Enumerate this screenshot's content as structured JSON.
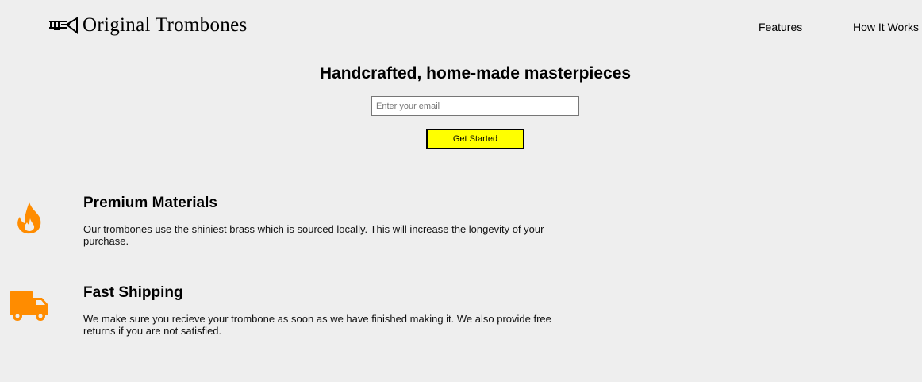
{
  "header": {
    "logo_text": "Original Trombones",
    "logo_icon": "trombone-icon",
    "nav": [
      {
        "label": "Features"
      },
      {
        "label": "How It Works"
      }
    ]
  },
  "hero": {
    "title": "Handcrafted, home-made masterpieces",
    "email_placeholder": "Enter your email",
    "email_value": "",
    "cta_label": "Get Started"
  },
  "features": [
    {
      "icon": "flame-icon",
      "title": "Premium Materials",
      "description": "Our trombones use the shiniest brass which is sourced locally. This will increase the longevity of your purchase."
    },
    {
      "icon": "truck-icon",
      "title": "Fast Shipping",
      "description": "We make sure you recieve your trombone as soon as we have finished making it. We also provide free returns if you are not satisfied."
    }
  ],
  "colors": {
    "background": "#eeeeee",
    "cta": "#ffff00",
    "icon_accent": "#ff8c00"
  }
}
